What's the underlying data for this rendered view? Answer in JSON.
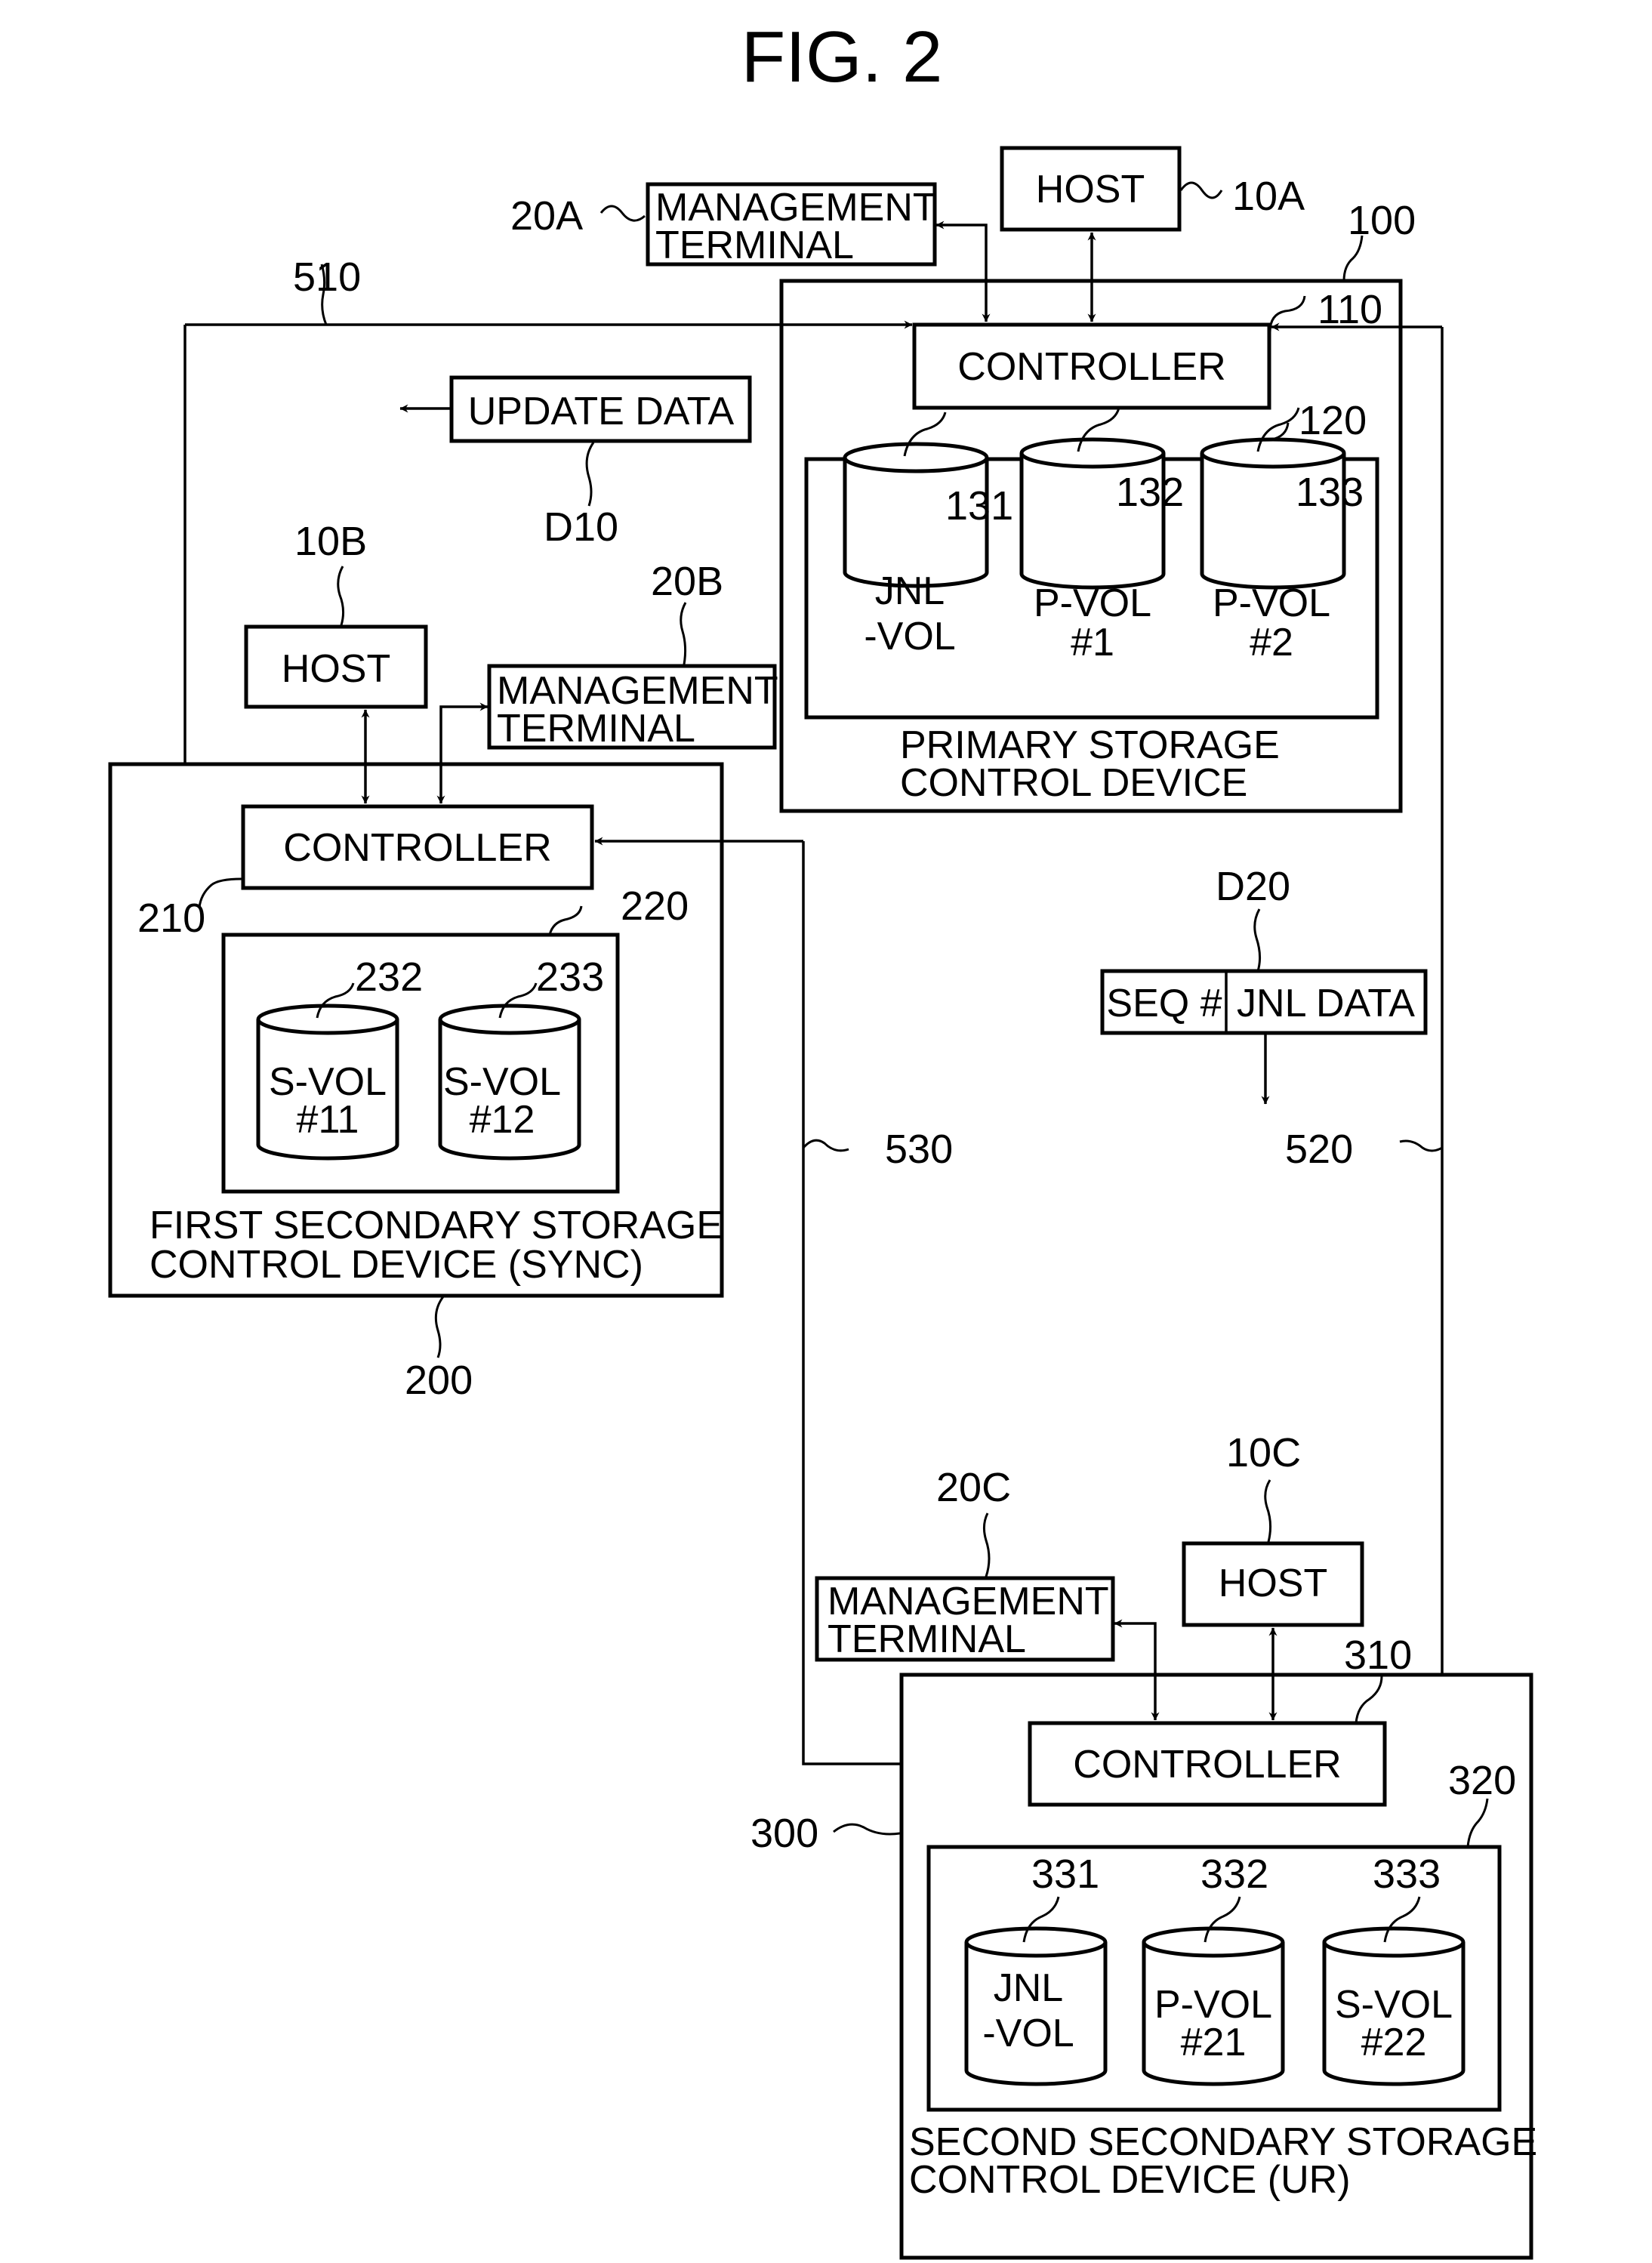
{
  "figure": {
    "title": "FIG. 2"
  },
  "primary": {
    "ref": "100",
    "name_line1": "PRIMARY STORAGE",
    "name_line2": "CONTROL DEVICE",
    "controller": {
      "label": "CONTROLLER",
      "ref": "110"
    },
    "volume_group_ref": "120",
    "volumes": [
      {
        "ref": "131",
        "line1": "JNL",
        "line2": "-VOL"
      },
      {
        "ref": "132",
        "line1": "P-VOL",
        "line2": "#1"
      },
      {
        "ref": "133",
        "line1": "P-VOL",
        "line2": "#2"
      }
    ],
    "host": {
      "label": "HOST",
      "ref": "10A"
    },
    "terminal": {
      "line1": "MANAGEMENT",
      "line2": "TERMINAL",
      "ref": "20A"
    }
  },
  "first_secondary": {
    "ref": "200",
    "name_line1": "FIRST SECONDARY STORAGE",
    "name_line2": "CONTROL DEVICE (SYNC)",
    "controller": {
      "label": "CONTROLLER",
      "ref": "210"
    },
    "volume_group_ref": "220",
    "volumes": [
      {
        "ref": "232",
        "line1": "S-VOL",
        "line2": "#11"
      },
      {
        "ref": "233",
        "line1": "S-VOL",
        "line2": "#12"
      }
    ],
    "host": {
      "label": "HOST",
      "ref": "10B"
    },
    "terminal": {
      "line1": "MANAGEMENT",
      "line2": "TERMINAL",
      "ref": "20B"
    }
  },
  "second_secondary": {
    "ref": "300",
    "name_line1": "SECOND SECONDARY STORAGE",
    "name_line2": "CONTROL DEVICE (UR)",
    "controller": {
      "label": "CONTROLLER",
      "ref": "310"
    },
    "volume_group_ref": "320",
    "volumes": [
      {
        "ref": "331",
        "line1": "JNL",
        "line2": "-VOL"
      },
      {
        "ref": "332",
        "line1": "P-VOL",
        "line2": "#21"
      },
      {
        "ref": "333",
        "line1": "S-VOL",
        "line2": "#22"
      }
    ],
    "host": {
      "label": "HOST",
      "ref": "10C"
    },
    "terminal": {
      "line1": "MANAGEMENT",
      "line2": "TERMINAL",
      "ref": "20C"
    }
  },
  "links": {
    "l510": "510",
    "l520": "520",
    "l530": "530"
  },
  "update_data": {
    "label": "UPDATE DATA",
    "ref": "D10"
  },
  "journal_data": {
    "seq_label": "SEQ #",
    "data_label": "JNL DATA",
    "ref": "D20"
  }
}
